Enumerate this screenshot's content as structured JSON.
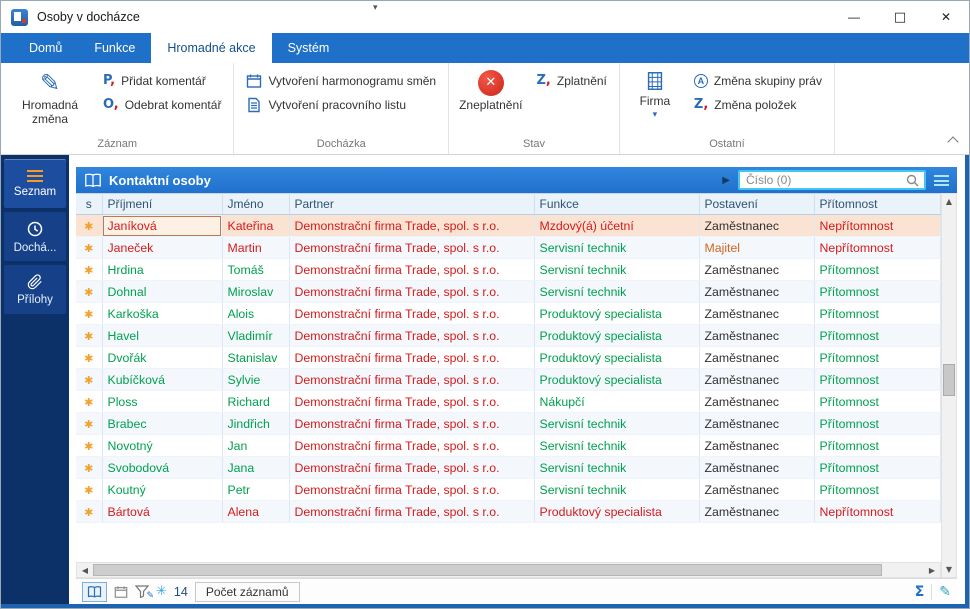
{
  "window": {
    "title": "Osoby v docházce",
    "controls": {
      "minimize": "—",
      "maximize": "□",
      "close": "✕"
    }
  },
  "icons": {
    "pencil": "✎",
    "add_comment": "P",
    "remove_comment": "O",
    "validate": "Z",
    "rights": "A",
    "change_items": "Z",
    "dropdown": "▾",
    "play": "▶",
    "snowflake": "✳",
    "sum": "Σ",
    "edit_pencil": "✎",
    "qat": "▾",
    "arrow_up": "▲",
    "arrow_down": "▼",
    "arrow_left": "◀",
    "arrow_right": "▶"
  },
  "ribbon": {
    "tabs": [
      {
        "label": "Domů",
        "active": false
      },
      {
        "label": "Funkce",
        "active": false
      },
      {
        "label": "Hromadné akce",
        "active": true
      },
      {
        "label": "Systém",
        "active": false
      }
    ],
    "groups": [
      {
        "label": "Záznam",
        "big": "Hromadná změna",
        "items": [
          "Přidat komentář",
          "Odebrat komentář"
        ]
      },
      {
        "label": "Docházka",
        "items": [
          "Vytvoření harmonogramu směn",
          "Vytvoření pracovního listu"
        ]
      },
      {
        "label": "Stav",
        "big": "Zneplatnění",
        "items": [
          "Zplatnění"
        ]
      },
      {
        "label": "Ostatní",
        "big": "Firma",
        "items": [
          "Změna skupiny práv",
          "Změna položek"
        ]
      }
    ]
  },
  "sidebar": {
    "items": [
      {
        "label": "Seznam",
        "active": true
      },
      {
        "label": "Dochá...",
        "active": false
      },
      {
        "label": "Přílohy",
        "active": false
      }
    ]
  },
  "content": {
    "header": {
      "title": "Kontaktní osoby",
      "search_placeholder": "Číslo (0)"
    },
    "table": {
      "columns": [
        "s",
        "Příjmení",
        "Jméno",
        "Partner",
        "Funkce",
        "Postavení",
        "Přítomnost"
      ],
      "star_glyph": "✱",
      "rows": [
        {
          "prijmeni": "Janíková",
          "jmeno": "Kateřina",
          "partner": "Demonstrační firma Trade, spol. s r.o.",
          "funkce": "Mzdový(á) účetní",
          "postaveni": "Zaměstnanec",
          "pritomnost": "Nepřítomnost",
          "selected": true,
          "colors": {
            "name": "red",
            "partner": "red",
            "funkce": "red",
            "postaveni": "dark",
            "pritomnost": "red"
          }
        },
        {
          "prijmeni": "Janeček",
          "jmeno": "Martin",
          "partner": "Demonstrační firma Trade, spol. s r.o.",
          "funkce": "Servisní technik",
          "postaveni": "Majitel",
          "pritomnost": "Nepřítomnost",
          "selected": false,
          "colors": {
            "name": "red",
            "partner": "red",
            "funkce": "green",
            "postaveni": "orange",
            "pritomnost": "red"
          }
        },
        {
          "prijmeni": "Hrdina",
          "jmeno": "Tomáš",
          "partner": "Demonstrační firma Trade, spol. s r.o.",
          "funkce": "Servisní technik",
          "postaveni": "Zaměstnanec",
          "pritomnost": "Přítomnost",
          "selected": false,
          "colors": {
            "name": "green",
            "partner": "red",
            "funkce": "green",
            "postaveni": "dark",
            "pritomnost": "green"
          }
        },
        {
          "prijmeni": "Dohnal",
          "jmeno": "Miroslav",
          "partner": "Demonstrační firma Trade, spol. s r.o.",
          "funkce": "Servisní technik",
          "postaveni": "Zaměstnanec",
          "pritomnost": "Přítomnost",
          "selected": false,
          "colors": {
            "name": "green",
            "partner": "red",
            "funkce": "green",
            "postaveni": "dark",
            "pritomnost": "green"
          }
        },
        {
          "prijmeni": "Karkoška",
          "jmeno": "Alois",
          "partner": "Demonstrační firma Trade, spol. s r.o.",
          "funkce": "Produktový specialista",
          "postaveni": "Zaměstnanec",
          "pritomnost": "Přítomnost",
          "selected": false,
          "colors": {
            "name": "green",
            "partner": "red",
            "funkce": "green",
            "postaveni": "dark",
            "pritomnost": "green"
          }
        },
        {
          "prijmeni": "Havel",
          "jmeno": "Vladimír",
          "partner": "Demonstrační firma Trade, spol. s r.o.",
          "funkce": "Produktový specialista",
          "postaveni": "Zaměstnanec",
          "pritomnost": "Přítomnost",
          "selected": false,
          "colors": {
            "name": "green",
            "partner": "red",
            "funkce": "green",
            "postaveni": "dark",
            "pritomnost": "green"
          }
        },
        {
          "prijmeni": "Dvořák",
          "jmeno": "Stanislav",
          "partner": "Demonstrační firma Trade, spol. s r.o.",
          "funkce": "Produktový specialista",
          "postaveni": "Zaměstnanec",
          "pritomnost": "Přítomnost",
          "selected": false,
          "colors": {
            "name": "green",
            "partner": "red",
            "funkce": "green",
            "postaveni": "dark",
            "pritomnost": "green"
          }
        },
        {
          "prijmeni": "Kubíčková",
          "jmeno": "Sylvie",
          "partner": "Demonstrační firma Trade, spol. s r.o.",
          "funkce": "Produktový specialista",
          "postaveni": "Zaměstnanec",
          "pritomnost": "Přítomnost",
          "selected": false,
          "colors": {
            "name": "green",
            "partner": "red",
            "funkce": "green",
            "postaveni": "dark",
            "pritomnost": "green"
          }
        },
        {
          "prijmeni": "Ploss",
          "jmeno": "Richard",
          "partner": "Demonstrační firma Trade, spol. s r.o.",
          "funkce": "Nákupčí",
          "postaveni": "Zaměstnanec",
          "pritomnost": "Přítomnost",
          "selected": false,
          "colors": {
            "name": "green",
            "partner": "red",
            "funkce": "green",
            "postaveni": "dark",
            "pritomnost": "green"
          }
        },
        {
          "prijmeni": "Brabec",
          "jmeno": "Jindřich",
          "partner": "Demonstrační firma Trade, spol. s r.o.",
          "funkce": "Servisní technik",
          "postaveni": "Zaměstnanec",
          "pritomnost": "Přítomnost",
          "selected": false,
          "colors": {
            "name": "green",
            "partner": "red",
            "funkce": "green",
            "postaveni": "dark",
            "pritomnost": "green"
          }
        },
        {
          "prijmeni": "Novotný",
          "jmeno": "Jan",
          "partner": "Demonstrační firma Trade, spol. s r.o.",
          "funkce": "Servisní technik",
          "postaveni": "Zaměstnanec",
          "pritomnost": "Přítomnost",
          "selected": false,
          "colors": {
            "name": "green",
            "partner": "red",
            "funkce": "green",
            "postaveni": "dark",
            "pritomnost": "green"
          }
        },
        {
          "prijmeni": "Svobodová",
          "jmeno": "Jana",
          "partner": "Demonstrační firma Trade, spol. s r.o.",
          "funkce": "Servisní technik",
          "postaveni": "Zaměstnanec",
          "pritomnost": "Přítomnost",
          "selected": false,
          "colors": {
            "name": "green",
            "partner": "red",
            "funkce": "green",
            "postaveni": "dark",
            "pritomnost": "green"
          }
        },
        {
          "prijmeni": "Koutný",
          "jmeno": "Petr",
          "partner": "Demonstrační firma Trade, spol. s r.o.",
          "funkce": "Servisní technik",
          "postaveni": "Zaměstnanec",
          "pritomnost": "Přítomnost",
          "selected": false,
          "colors": {
            "name": "green",
            "partner": "red",
            "funkce": "green",
            "postaveni": "dark",
            "pritomnost": "green"
          }
        },
        {
          "prijmeni": "Bártová",
          "jmeno": "Alena",
          "partner": "Demonstrační firma Trade, spol. s r.o.",
          "funkce": "Produktový specialista",
          "postaveni": "Zaměstnanec",
          "pritomnost": "Nepřítomnost",
          "selected": false,
          "colors": {
            "name": "red",
            "partner": "red",
            "funkce": "red",
            "postaveni": "dark",
            "pritomnost": "red"
          }
        }
      ]
    },
    "statusbar": {
      "count": "14",
      "count_label": "Počet záznamů"
    }
  },
  "colors": {
    "red": "#D61A1A",
    "green": "#00A14E",
    "dark": "#303030",
    "orange": "#D2651E",
    "accent_blue": "#1F70C8"
  }
}
